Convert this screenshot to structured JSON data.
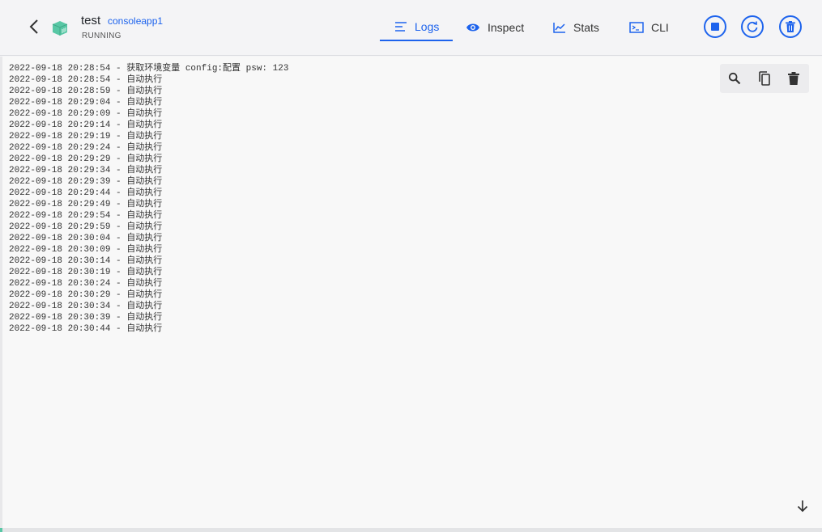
{
  "container": {
    "name": "test",
    "image": "consoleapp1",
    "status": "RUNNING"
  },
  "tabs": [
    {
      "label": "Logs",
      "icon": "logs-icon",
      "active": true
    },
    {
      "label": "Inspect",
      "icon": "eye-icon",
      "active": false
    },
    {
      "label": "Stats",
      "icon": "chart-line-icon",
      "active": false
    },
    {
      "label": "CLI",
      "icon": "terminal-icon",
      "active": false
    }
  ],
  "actions": {
    "stop_icon": "stop-icon",
    "restart_icon": "restart-icon",
    "delete_icon": "trash-icon"
  },
  "log_tools": [
    "search-icon",
    "copy-icon",
    "trash-icon"
  ],
  "logs": [
    "2022-09-18 20:28:54 - 获取环境变量 config:配置 psw: 123",
    "2022-09-18 20:28:54 - 自动执行",
    "2022-09-18 20:28:59 - 自动执行",
    "2022-09-18 20:29:04 - 自动执行",
    "2022-09-18 20:29:09 - 自动执行",
    "2022-09-18 20:29:14 - 自动执行",
    "2022-09-18 20:29:19 - 自动执行",
    "2022-09-18 20:29:24 - 自动执行",
    "2022-09-18 20:29:29 - 自动执行",
    "2022-09-18 20:29:34 - 自动执行",
    "2022-09-18 20:29:39 - 自动执行",
    "2022-09-18 20:29:44 - 自动执行",
    "2022-09-18 20:29:49 - 自动执行",
    "2022-09-18 20:29:54 - 自动执行",
    "2022-09-18 20:29:59 - 自动执行",
    "2022-09-18 20:30:04 - 自动执行",
    "2022-09-18 20:30:09 - 自动执行",
    "2022-09-18 20:30:14 - 自动执行",
    "2022-09-18 20:30:19 - 自动执行",
    "2022-09-18 20:30:24 - 自动执行",
    "2022-09-18 20:30:29 - 自动执行",
    "2022-09-18 20:30:34 - 自动执行",
    "2022-09-18 20:30:39 - 自动执行",
    "2022-09-18 20:30:44 - 自动执行"
  ],
  "colors": {
    "accent": "#1d63ed",
    "container_icon": "#58c7a5",
    "background": "#f4f4f6"
  }
}
